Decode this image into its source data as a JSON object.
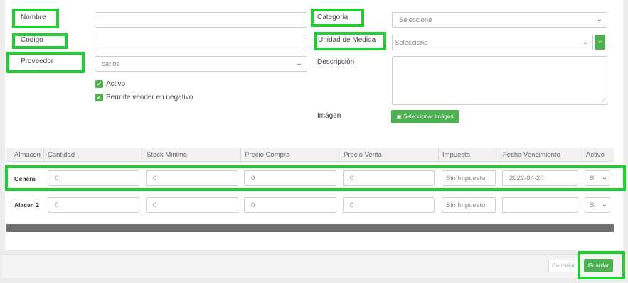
{
  "form": {
    "nombre_label": "Nombre",
    "nombre_value": "",
    "codigo_label": "Codigo",
    "codigo_value": "",
    "proveedor_label": "Proveedor",
    "proveedor_value": "carlos",
    "categoria_label": "Categoria",
    "categoria_value": "Seleccione",
    "unidad_label": "Unidad de Medida",
    "unidad_value": "Seleccione",
    "unidad_add": "+",
    "descripcion_label": "Descripción",
    "activo_label": "Activo",
    "negativo_label": "Permite vender en negativo",
    "imagen_label": "Imágen",
    "imagen_button": "Seleccionar Imágen"
  },
  "table": {
    "headers": [
      "Almacen",
      "Cantidad",
      "Stock Minimo",
      "Precio Compra",
      "Precio Venta",
      "Impuesto",
      "Fecha Vencimiento",
      "Activo"
    ],
    "rows": [
      {
        "almacen": "General",
        "cantidad": "0",
        "stock_minimo": "0",
        "precio_compra": "0",
        "precio_venta": "0",
        "impuesto": "Sin Impuesto",
        "fecha": "2022-04-20",
        "activo": "Si"
      },
      {
        "almacen": "Alacen 2",
        "cantidad": "0",
        "stock_minimo": "0",
        "precio_compra": "0",
        "precio_venta": "0",
        "impuesto": "Sin Impuesto",
        "fecha": "",
        "activo": "Si"
      }
    ]
  },
  "footer": {
    "cancel_label": "Cancelar",
    "save_label": "Guardar"
  },
  "colors": {
    "accent": "#4caf50",
    "highlight": "#22cc33"
  },
  "icons": {
    "check": "check-icon",
    "image": "image-icon",
    "chevron": "chevron-down-icon"
  }
}
